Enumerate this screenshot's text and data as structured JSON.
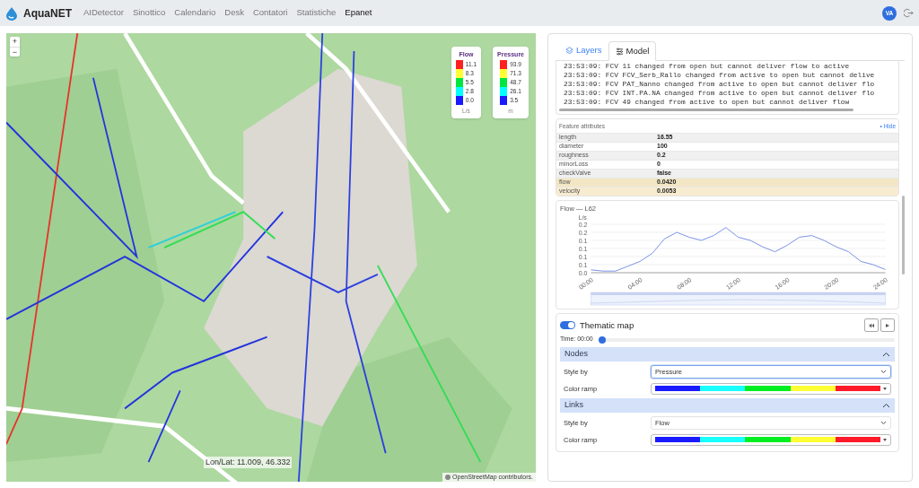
{
  "app": {
    "name": "AquaNET",
    "avatar": "VA",
    "nav": [
      {
        "label": "AIDetector",
        "selected": false
      },
      {
        "label": "Sinottico",
        "selected": false
      },
      {
        "label": "Calendario",
        "selected": false
      },
      {
        "label": "Desk",
        "selected": false
      },
      {
        "label": "Contatori",
        "selected": false
      },
      {
        "label": "Statistiche",
        "selected": false
      },
      {
        "label": "Epanet",
        "selected": true
      }
    ]
  },
  "map": {
    "zoom_in": "+",
    "zoom_out": "−",
    "coordinates": "Lon/Lat: 11.009, 46.332",
    "attribution": "OpenStreetMap contributors.",
    "legends": [
      {
        "title": "Flow",
        "unit": "L/s",
        "bins": [
          {
            "label": "11.1",
            "color": "#ff2020"
          },
          {
            "label": "8.3",
            "color": "#ffff33"
          },
          {
            "label": "5.5",
            "color": "#00e640"
          },
          {
            "label": "2.8",
            "color": "#00ffff"
          },
          {
            "label": "0.0",
            "color": "#1a1aff"
          }
        ]
      },
      {
        "title": "Pressure",
        "unit": "m",
        "bins": [
          {
            "label": "93.9",
            "color": "#ff2020"
          },
          {
            "label": "71.3",
            "color": "#ffff33"
          },
          {
            "label": "48.7",
            "color": "#00e640"
          },
          {
            "label": "26.1",
            "color": "#00ffff"
          },
          {
            "label": "3.5",
            "color": "#1a1aff"
          }
        ]
      }
    ]
  },
  "panel": {
    "tabs": [
      {
        "label": "Layers",
        "selected": false
      },
      {
        "label": "Model",
        "selected": true
      }
    ],
    "log": [
      "23:53:09: FCV 11 changed from open but cannot deliver flow to active",
      "23:53:09: FCV FCV_Serb_Rallo changed from active to open but cannot delive",
      "23:53:09: FCV PAT_Nanno changed from active to open but cannot deliver flo",
      "23:53:09: FCV INT.PA.NA changed from active to open but cannot deliver flo",
      "23:53:09: FCV 49 changed from active to open but cannot deliver flow"
    ],
    "attributes": {
      "title": "Feature attributes",
      "hide": "• Hide",
      "rows": [
        {
          "name": "length",
          "value": "16.55",
          "highlighted": false
        },
        {
          "name": "diameter",
          "value": "100",
          "highlighted": false
        },
        {
          "name": "roughness",
          "value": "0.2",
          "highlighted": false
        },
        {
          "name": "minorLoss",
          "value": "0",
          "highlighted": false
        },
        {
          "name": "checkValve",
          "value": "false",
          "highlighted": false
        },
        {
          "name": "flow",
          "value": "0.0420",
          "highlighted": true
        },
        {
          "name": "velocity",
          "value": "0.0053",
          "highlighted": true
        }
      ]
    },
    "chart": {
      "chart_data": {
        "type": "line",
        "title": "Flow — L62",
        "ylabel": "L/s",
        "x": [
          0,
          1,
          2,
          3,
          4,
          5,
          6,
          7,
          8,
          9,
          10,
          11,
          12,
          13,
          14,
          15,
          16,
          17,
          18,
          19,
          20,
          21,
          22,
          23,
          24
        ],
        "grid": true,
        "series": [
          {
            "color": "#7b93e8",
            "values": [
              0.054,
              0.05,
              0.05,
              0.065,
              0.08,
              0.105,
              0.15,
              0.17,
              0.155,
              0.145,
              0.16,
              0.185,
              0.155,
              0.145,
              0.125,
              0.11,
              0.13,
              0.155,
              0.16,
              0.145,
              0.125,
              0.11,
              0.08,
              0.07,
              0.055
            ]
          }
        ],
        "xlim": [
          0,
          24
        ],
        "ylim": [
          0.045,
          0.195
        ],
        "xticks": [
          {
            "value": 0,
            "label": "00:00"
          },
          {
            "value": 4,
            "label": "04:00"
          },
          {
            "value": 8,
            "label": "08:00"
          },
          {
            "value": 12,
            "label": "12:00"
          },
          {
            "value": 16,
            "label": "16:00"
          },
          {
            "value": 20,
            "label": "20:00"
          },
          {
            "value": 24,
            "label": "24:00"
          }
        ],
        "yticks": [
          {
            "value": 0.045,
            "label": "0.0"
          },
          {
            "value": 0.07,
            "label": "0.1"
          },
          {
            "value": 0.095,
            "label": "0.1"
          },
          {
            "value": 0.12,
            "label": "0.1"
          },
          {
            "value": 0.145,
            "label": "0.1"
          },
          {
            "value": 0.17,
            "label": "0.2"
          },
          {
            "value": 0.195,
            "label": "0.2"
          }
        ]
      }
    },
    "thematic": {
      "label": "Thematic map",
      "on": true,
      "time": {
        "label": "Time: 00:00",
        "level": 0
      },
      "sections": [
        {
          "title": "Nodes",
          "expanded": true,
          "fields": [
            {
              "kind": "select",
              "label": "Style by",
              "value": "Pressure",
              "focused": true
            },
            {
              "kind": "ramp",
              "label": "Color ramp",
              "ramp": [
                {
                  "color": "#1a1aff"
                },
                {
                  "color": "#19ffff"
                },
                {
                  "color": "#00ee22"
                },
                {
                  "color": "#ffff33"
                },
                {
                  "color": "#ff1a2a"
                }
              ]
            }
          ]
        },
        {
          "title": "Links",
          "expanded": true,
          "fields": [
            {
              "kind": "select",
              "label": "Style by",
              "value": "Flow",
              "focused": false
            },
            {
              "kind": "ramp",
              "label": "Color ramp",
              "ramp": [
                {
                  "color": "#1a1aff"
                },
                {
                  "color": "#19ffff"
                },
                {
                  "color": "#00ee22"
                },
                {
                  "color": "#ffff33"
                },
                {
                  "color": "#ff1a2a"
                }
              ]
            }
          ]
        }
      ]
    }
  }
}
